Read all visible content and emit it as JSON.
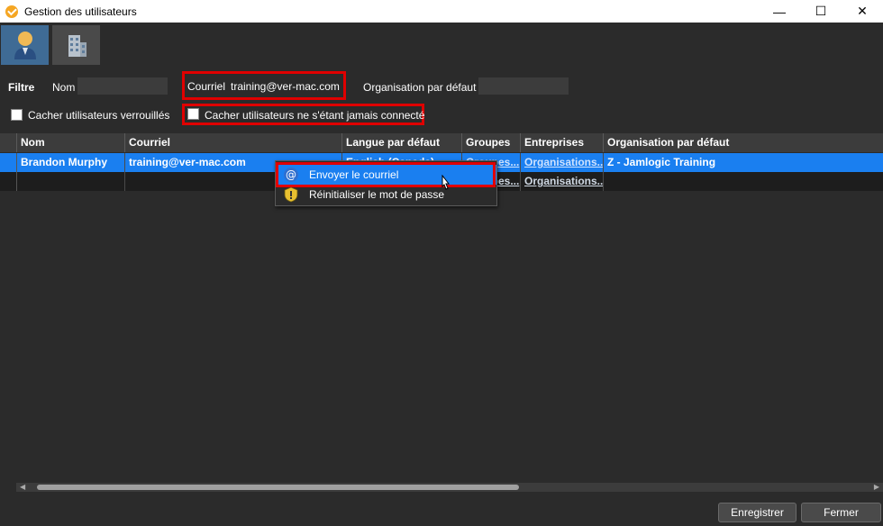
{
  "window": {
    "title": "Gestion des utilisateurs",
    "minimize": "—",
    "maximize": "☐",
    "close": "✕"
  },
  "tabs": [
    {
      "name": "users",
      "icon": "user-icon"
    },
    {
      "name": "organizations",
      "icon": "building-icon"
    }
  ],
  "filter": {
    "title": "Filtre",
    "name_label": "Nom",
    "name_value": "",
    "email_label": "Courriel",
    "email_value": "training@ver-mac.com",
    "org_label": "Organisation par défaut",
    "org_value": "",
    "hide_locked_label": "Cacher utilisateurs verrouillés",
    "hide_never_connected_label": "Cacher utilisateurs ne s'étant jamais connecté"
  },
  "grid": {
    "columns": [
      "Nom",
      "Courriel",
      "Langue par défaut",
      "Groupes",
      "Entreprises",
      "Organisation par défaut"
    ],
    "rows": [
      {
        "nom": "Brandon Murphy",
        "courriel": "training@ver-mac.com",
        "langue": "English (Canada)",
        "groupes": "Groupes...",
        "entreprises": "Organisations...",
        "organisation": "Z - Jamlogic Training"
      },
      {
        "nom": "",
        "courriel": "",
        "langue": "",
        "groupes": "Groupes...",
        "entreprises": "Organisations...",
        "organisation": ""
      }
    ]
  },
  "context_menu": {
    "send_email": "Envoyer le courriel",
    "reset_password": "Réinitialiser le mot de passe"
  },
  "buttons": {
    "save": "Enregistrer",
    "close": "Fermer"
  },
  "colors": {
    "selection": "#1a7ff0",
    "highlight_box": "#e00000",
    "background": "#2b2b2b"
  }
}
